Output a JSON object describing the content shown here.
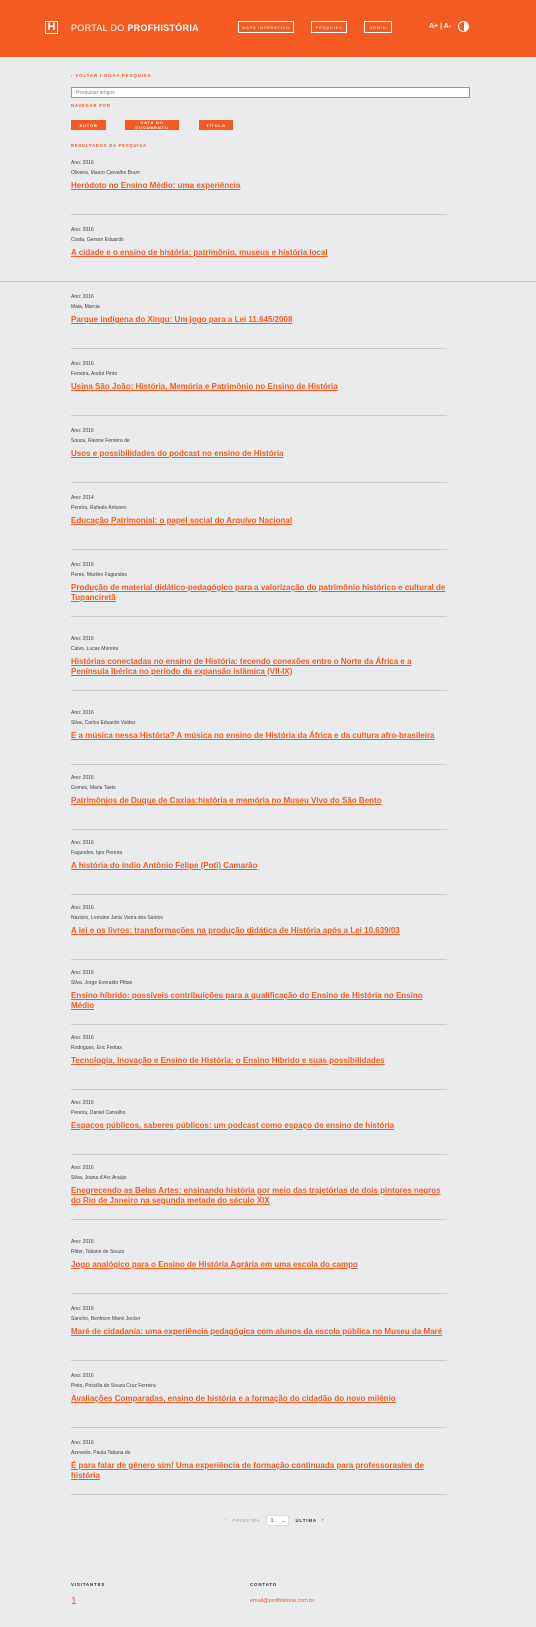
{
  "header": {
    "logo_letter": "H",
    "brand_prefix": "PORTAL DO ",
    "brand_name": "PROFHISTÓRIA",
    "nav": [
      "MAPA INTERATIVO",
      "PESQUISA",
      "ADMIN"
    ],
    "font_size": "A+ | A-",
    "accent": "#f45b22"
  },
  "search": {
    "back_label": "‹  VOLTAR / NOVA PESQUISA",
    "placeholder": "Pesquisar artigos",
    "browse_label": "NAVEGAR POR",
    "browse_buttons": [
      "AUTOR",
      "DATA DO DOCUMENTO",
      "TÍTULO"
    ],
    "results_label": "RESULTADOS DA PESQUISA"
  },
  "results": [
    {
      "year": "Ano: 2016",
      "authors": "Oliveira, Mauro Carvalho Brum",
      "title": "Heródoto no Ensino Médio: uma experiência"
    },
    {
      "year": "Ano: 2016",
      "authors": "Costa, Gerson Eduardo",
      "title": "A cidade e o ensino de história: patrimônio, museus e história local"
    },
    {
      "year": "Ano: 2016",
      "authors": "Maia, Marcia",
      "title": "Parque indígena do Xingu: Um jogo para a Lei 11.645/2008"
    },
    {
      "year": "Ano: 2016",
      "authors": "Ferreira, André Pinto",
      "title": "Usina São João: História, Memória e Patrimônio no Ensino de História"
    },
    {
      "year": "Ano: 2016",
      "authors": "Souza, Raione Ferreira de",
      "title": "Usos e possibilidades do podcast no ensino de História"
    },
    {
      "year": "Ano: 2014",
      "authors": "Pereira, Rafaele Antunes",
      "title": "Educação Patrimonial: o papel social do Arquivo Nacional"
    },
    {
      "year": "Ano: 2016",
      "authors": "Peres, Marilen Fagundes",
      "title": "Produção de material didático-pedagógico para a valorização do patrimônio histórico e cultural de Tupanciretã"
    },
    {
      "year": "Ano: 2016",
      "authors": "Calvo, Lucas Moreira",
      "title": "Histórias conectadas no ensino de História: tecendo conexões entre o Norte da África e a Península Ibérica no período da expansão islâmica (VII-IX)"
    },
    {
      "year": "Ano: 2016",
      "authors": "Silva, Carlos Eduardo Valdez",
      "title": "E a música nessa História? A música no ensino de História da África e da cultura afro-brasileira"
    },
    {
      "year": "Ano: 2016",
      "authors": "Gomes, Maria Taets",
      "title": "Patrimônios de Duque de Caxias:história e memória no Museu Vivo do São Bento"
    },
    {
      "year": "Ano: 2016",
      "authors": "Fagundes, Igor Pereira",
      "title": "A história do índio Antônio Felipe (Poti) Camarão"
    },
    {
      "year": "Ano: 2016",
      "authors": "Nazário, Lorraine Janis Vieira dos Santos",
      "title": "A lei e os livros: transformações na produção didática de História após a Lei 10.639/03"
    },
    {
      "year": "Ano: 2016",
      "authors": "Silva, Jorge Everaldo Pittan",
      "title": "Ensino híbrido: possíveis contribuições para a qualificação do Ensino de História no Ensino Médio"
    },
    {
      "year": "Ano: 2016",
      "authors": "Rodrigues, Eric Freitas",
      "title": "Tecnologia, Inovação e Ensino de História: o Ensino Híbrido e suas possibilidades"
    },
    {
      "year": "Ano: 2016",
      "authors": "Pereira, Daniel Carvalho",
      "title": "Espaços públicos, saberes públicos: um podcast como espaço de ensino de história"
    },
    {
      "year": "Ano: 2016",
      "authors": "Silva, Joana d'Arc Araújo",
      "title": "Enegrecendo as Belas Artes: ensinando história por meio das trajetórias de dois pintores negros do Rio de Janeiro na segunda metade do século XIX"
    },
    {
      "year": "Ano: 2016",
      "authors": "Ritter, Tatiane de Souza",
      "title": "Jogo analógico para o Ensino de História Agrária em uma escola do campo"
    },
    {
      "year": "Ano: 2016",
      "authors": "Sancho, Benhson Mario Jecker",
      "title": "Maré de cidadania: uma experiência pedagógica com alunos da escola pública no Museu da Maré"
    },
    {
      "year": "Ano: 2016",
      "authors": "Pinto, Priscilla de Souza Cruz Ferreira",
      "title": "Avaliações Comparadas, ensino de história e a formação do cidadão do novo milênio"
    },
    {
      "year": "Ano: 2016",
      "authors": "Azevedo, Paula Tatiana de",
      "title": "É para falar de gênero sim! Uma experiência de formação continuada para professoras/es de história"
    }
  ],
  "pagination": {
    "first": "PRIMEIRA",
    "page": "1",
    "last": "ÚLTIMA"
  },
  "footer": {
    "visitors_label": "VISITANTES",
    "visitors_count": "1",
    "contact_label": "CONTATO",
    "email": "email@profhistoria.com.br"
  }
}
